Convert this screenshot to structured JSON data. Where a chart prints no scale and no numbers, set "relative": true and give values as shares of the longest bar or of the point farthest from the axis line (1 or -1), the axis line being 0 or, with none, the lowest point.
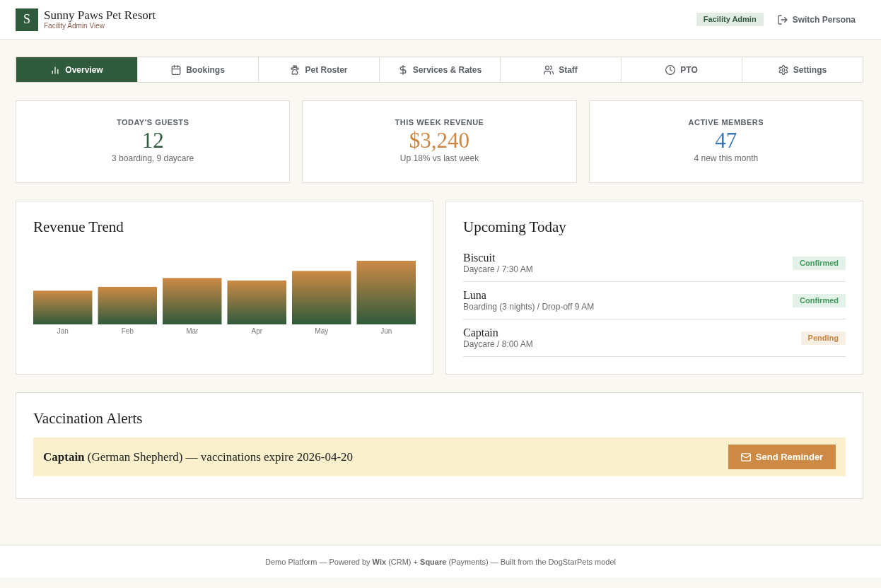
{
  "header": {
    "logo": "S",
    "title": "Sunny Paws Pet Resort",
    "subtitle": "Facility Admin View",
    "role_badge": "Facility Admin",
    "switch_button": "Switch Persona"
  },
  "tabs": [
    {
      "label": "Overview",
      "selected": true
    },
    {
      "label": "Bookings",
      "selected": false
    },
    {
      "label": "Pet Roster",
      "selected": false
    },
    {
      "label": "Services & Rates",
      "selected": false
    },
    {
      "label": "Staff",
      "selected": false
    },
    {
      "label": "PTO",
      "selected": false
    },
    {
      "label": "Settings",
      "selected": false
    }
  ],
  "stats": [
    {
      "label": "TODAY'S GUESTS",
      "value": "12",
      "note": "3 boarding, 9 daycare",
      "color": "#2f5a3c"
    },
    {
      "label": "THIS WEEK REVENUE",
      "value": "$3,240",
      "note": "Up 18% vs last week",
      "color": "#cc8640"
    },
    {
      "label": "ACTIVE MEMBERS",
      "value": "47",
      "note": "4 new this month",
      "color": "#3a78b8"
    }
  ],
  "revenue": {
    "title": "Revenue Trend",
    "chart_data": {
      "type": "bar",
      "relative": true,
      "categories": [
        "Jan",
        "Feb",
        "Mar",
        "Apr",
        "May",
        "Jun"
      ],
      "values": [
        0.53,
        0.59,
        0.73,
        0.69,
        0.84,
        1
      ]
    }
  },
  "upcoming": {
    "title": "Upcoming Today",
    "items": [
      {
        "name": "Biscuit",
        "detail": "Daycare / 7:30 AM",
        "status": "Confirmed",
        "color": "#3f9a5c"
      },
      {
        "name": "Luna",
        "detail": "Boarding (3 nights) / Drop-off 9 AM",
        "status": "Confirmed",
        "color": "#3f9a5c"
      },
      {
        "name": "Captain",
        "detail": "Daycare / 8:00 AM",
        "status": "Pending",
        "color": "#c98440"
      }
    ]
  },
  "vaccinations": {
    "title": "Vaccination Alerts",
    "alerts": [
      {
        "text": "**Captain** (German Shepherd) — vaccinations expire 2026-04-20",
        "button": "Send Reminder"
      }
    ]
  },
  "footer": {
    "text": "Demo Platform — Powered by **Wix** (CRM) + **Square** (Payments) — Built from the DogStarPets model"
  }
}
